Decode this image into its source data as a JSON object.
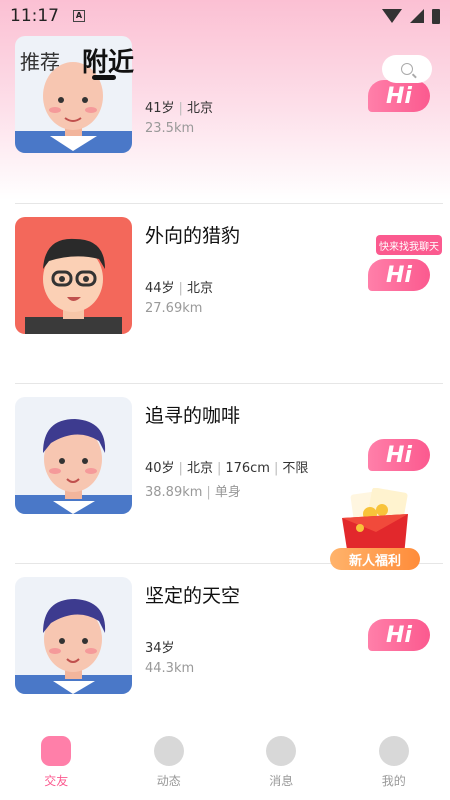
{
  "status_bar": {
    "time": "11:17",
    "a_badge": "A"
  },
  "top_tabs": {
    "recommend": "推荐",
    "nearby": "附近"
  },
  "users": [
    {
      "name": "",
      "info": [
        "41岁",
        "北京"
      ],
      "sub": [
        "23.5km"
      ],
      "hi": "Hi"
    },
    {
      "name": "外向的猎豹",
      "info": [
        "44岁",
        "北京"
      ],
      "sub": [
        "27.69km"
      ],
      "hi": "Hi",
      "bubble": "快来找我聊天"
    },
    {
      "name": "追寻的咖啡",
      "info": [
        "40岁",
        "北京",
        "176cm",
        "不限"
      ],
      "sub": [
        "38.89km",
        "单身"
      ],
      "hi": "Hi"
    },
    {
      "name": "坚定的天空",
      "info": [
        "34岁"
      ],
      "sub": [
        "44.3km"
      ],
      "hi": "Hi"
    }
  ],
  "redpack": {
    "label": "新人福利"
  },
  "tabbar": [
    {
      "label": "交友",
      "icon": "friends-icon",
      "active": true
    },
    {
      "label": "动态",
      "icon": "moments-icon",
      "active": false
    },
    {
      "label": "消息",
      "icon": "message-icon",
      "active": false
    },
    {
      "label": "我的",
      "icon": "profile-icon",
      "active": false
    }
  ],
  "colors": {
    "accent": "#fb5a8f",
    "hi_gradient_start": "#ff7fa9"
  }
}
